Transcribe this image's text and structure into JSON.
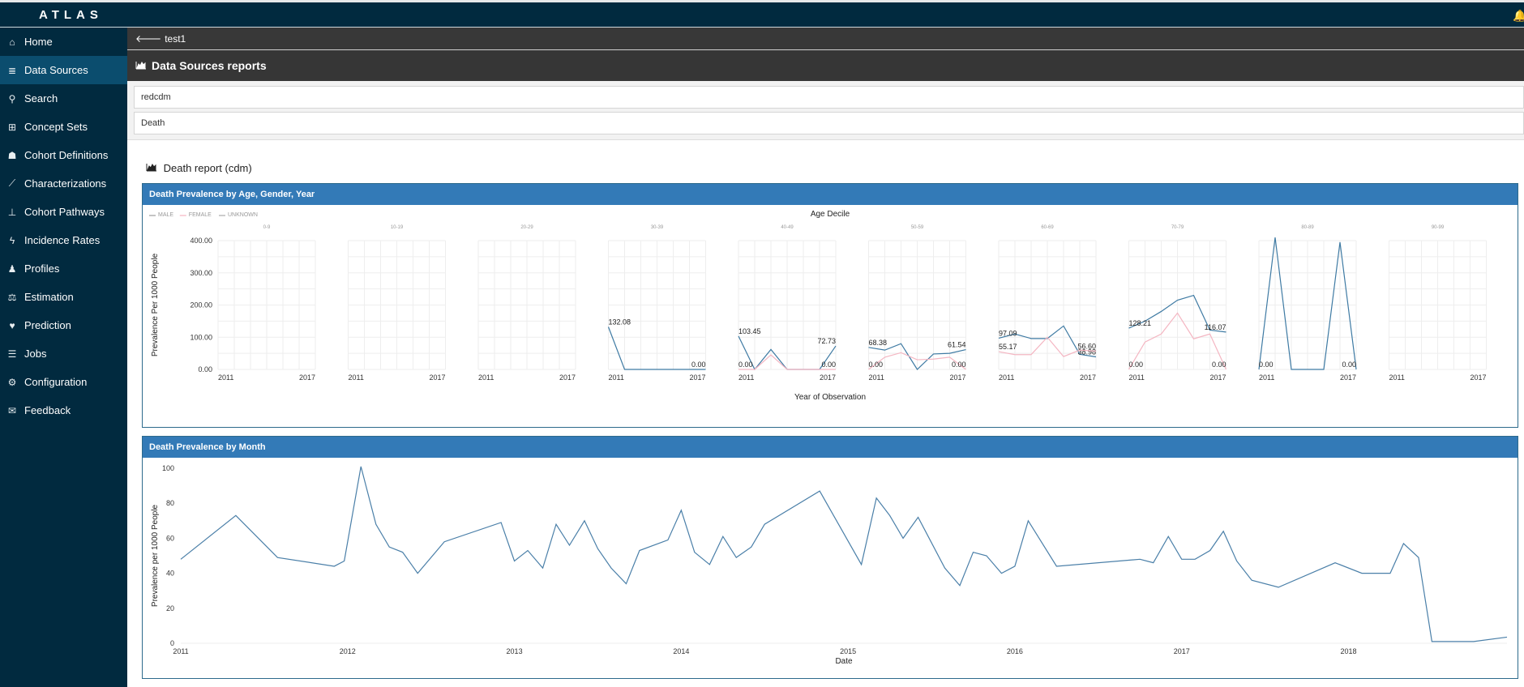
{
  "app": {
    "brand": "ATLAS",
    "notification_icon": "bell-icon"
  },
  "sidebar": {
    "items": [
      {
        "label": "Home",
        "icon": "home-icon",
        "glyph": "⌂",
        "active": false
      },
      {
        "label": "Data Sources",
        "icon": "database-icon",
        "glyph": "≣",
        "active": true
      },
      {
        "label": "Search",
        "icon": "search-icon",
        "glyph": "⚲",
        "active": false
      },
      {
        "label": "Concept Sets",
        "icon": "cart-icon",
        "glyph": "⊞",
        "active": false
      },
      {
        "label": "Cohort Definitions",
        "icon": "users-icon",
        "glyph": "☗",
        "active": false
      },
      {
        "label": "Characterizations",
        "icon": "line-chart-icon",
        "glyph": "⟋",
        "active": false
      },
      {
        "label": "Cohort Pathways",
        "icon": "sitemap-icon",
        "glyph": "⊥",
        "active": false
      },
      {
        "label": "Incidence Rates",
        "icon": "bolt-icon",
        "glyph": "ϟ",
        "active": false
      },
      {
        "label": "Profiles",
        "icon": "user-icon",
        "glyph": "♟",
        "active": false
      },
      {
        "label": "Estimation",
        "icon": "balance-scale-icon",
        "glyph": "⚖",
        "active": false
      },
      {
        "label": "Prediction",
        "icon": "heartbeat-icon",
        "glyph": "♥",
        "active": false
      },
      {
        "label": "Jobs",
        "icon": "list-icon",
        "glyph": "☰",
        "active": false
      },
      {
        "label": "Configuration",
        "icon": "cogs-icon",
        "glyph": "⚙",
        "active": false
      },
      {
        "label": "Feedback",
        "icon": "comment-icon",
        "glyph": "✉",
        "active": false
      }
    ]
  },
  "breadcrumb": {
    "back_label": "test1",
    "back_glyph": "🡐"
  },
  "page": {
    "title": "Data Sources reports",
    "title_icon": "area-chart-icon"
  },
  "selectors": {
    "source": "redcdm",
    "report": "Death"
  },
  "report": {
    "title": "Death report (cdm)"
  },
  "panels": {
    "age_gender_year": "Death Prevalence by Age, Gender, Year",
    "by_month": "Death Prevalence by Month"
  },
  "chart_data": [
    {
      "type": "line",
      "title": "Death Prevalence by Age, Gender, Year",
      "facet_title": "Age Decile",
      "xlabel": "Year of Observation",
      "ylabel": "Prevalence Per 1000 People",
      "ylim": [
        0,
        400
      ],
      "yticks": [
        "0.00",
        "100.00",
        "200.00",
        "300.00",
        "400.00"
      ],
      "x": [
        2011,
        2012,
        2013,
        2014,
        2015,
        2016,
        2017
      ],
      "xticks": [
        "2011",
        "2017"
      ],
      "legend": [
        "MALE",
        "FEMALE",
        "UNKNOWN"
      ],
      "legend_position": "top-left",
      "series_colors": {
        "MALE": "#1f77b4",
        "FEMALE": "#f4a6b4",
        "UNKNOWN": "#999999"
      },
      "facets": [
        {
          "label": "0-9",
          "series": []
        },
        {
          "label": "10-19",
          "series": []
        },
        {
          "label": "20-29",
          "series": []
        },
        {
          "label": "30-39",
          "series": [
            {
              "name": "MALE",
              "values": [
                132.08,
                0,
                0,
                0,
                0,
                0,
                0
              ]
            }
          ],
          "labels": [
            "132.08",
            "0.00"
          ]
        },
        {
          "label": "40-49",
          "series": [
            {
              "name": "MALE",
              "values": [
                103.45,
                0,
                62,
                0,
                0,
                0,
                72.73
              ]
            },
            {
              "name": "FEMALE",
              "values": [
                0,
                0,
                45,
                0,
                0,
                0,
                0
              ]
            }
          ],
          "labels": [
            "103.45",
            "0.00",
            "72.73",
            "0.00"
          ]
        },
        {
          "label": "50-59",
          "series": [
            {
              "name": "MALE",
              "values": [
                68.38,
                60,
                80,
                0,
                48,
                50,
                61.54
              ]
            },
            {
              "name": "FEMALE",
              "values": [
                0,
                38,
                52,
                30,
                32,
                38,
                0
              ]
            }
          ],
          "labels": [
            "68.38",
            "0.00",
            "61.54",
            "0.00"
          ]
        },
        {
          "label": "60-69",
          "series": [
            {
              "name": "MALE",
              "values": [
                97.09,
                110,
                96,
                96,
                135,
                47,
                38.98
              ]
            },
            {
              "name": "FEMALE",
              "values": [
                55.17,
                46,
                46,
                100,
                40,
                60,
                56.6
              ]
            }
          ],
          "labels": [
            "97.09",
            "55.17",
            "56.60",
            "38.98"
          ]
        },
        {
          "label": "70-79",
          "series": [
            {
              "name": "MALE",
              "values": [
                128.21,
                150,
                180,
                215,
                230,
                122,
                116.07
              ]
            },
            {
              "name": "FEMALE",
              "values": [
                0,
                85,
                110,
                175,
                95,
                110,
                0
              ]
            }
          ],
          "labels": [
            "128.21",
            "116.07",
            "0.00",
            "0.00"
          ]
        },
        {
          "label": "80-89",
          "series": [
            {
              "name": "MALE",
              "values": [
                0,
                410,
                0,
                0,
                0,
                395,
                0
              ]
            }
          ],
          "labels": [
            "0.00",
            "0.00"
          ]
        },
        {
          "label": "90-99",
          "series": []
        }
      ]
    },
    {
      "type": "line",
      "title": "Death Prevalence by Month",
      "xlabel": "Date",
      "ylabel": "Prevalence per 1000 People",
      "ylim": [
        0,
        100
      ],
      "yticks": [
        0,
        20,
        40,
        60,
        80,
        100
      ],
      "xticks": [
        "2011",
        "2012",
        "2013",
        "2014",
        "2015",
        "2016",
        "2017",
        "2018"
      ],
      "xlim": [
        2011.0,
        2018.95
      ],
      "color": "#4a7fa8",
      "points": [
        [
          2011.0,
          48
        ],
        [
          2011.33,
          73
        ],
        [
          2011.58,
          49
        ],
        [
          2011.92,
          44
        ],
        [
          2011.98,
          47
        ],
        [
          2012.08,
          101
        ],
        [
          2012.17,
          68
        ],
        [
          2012.25,
          55
        ],
        [
          2012.33,
          52
        ],
        [
          2012.42,
          40
        ],
        [
          2012.58,
          58
        ],
        [
          2012.92,
          69
        ],
        [
          2013.0,
          47
        ],
        [
          2013.08,
          53
        ],
        [
          2013.17,
          43
        ],
        [
          2013.25,
          68
        ],
        [
          2013.33,
          56
        ],
        [
          2013.42,
          70
        ],
        [
          2013.5,
          54
        ],
        [
          2013.58,
          43
        ],
        [
          2013.67,
          34
        ],
        [
          2013.75,
          53
        ],
        [
          2013.92,
          59
        ],
        [
          2014.0,
          76
        ],
        [
          2014.08,
          52
        ],
        [
          2014.17,
          45
        ],
        [
          2014.25,
          61
        ],
        [
          2014.33,
          49
        ],
        [
          2014.42,
          55
        ],
        [
          2014.5,
          68
        ],
        [
          2014.83,
          87
        ],
        [
          2015.08,
          45
        ],
        [
          2015.17,
          83
        ],
        [
          2015.25,
          73
        ],
        [
          2015.33,
          60
        ],
        [
          2015.42,
          72
        ],
        [
          2015.58,
          43
        ],
        [
          2015.67,
          33
        ],
        [
          2015.75,
          52
        ],
        [
          2015.83,
          50
        ],
        [
          2015.92,
          40
        ],
        [
          2016.0,
          44
        ],
        [
          2016.08,
          70
        ],
        [
          2016.25,
          44
        ],
        [
          2016.75,
          48
        ],
        [
          2016.83,
          46
        ],
        [
          2016.92,
          61
        ],
        [
          2017.0,
          48
        ],
        [
          2017.08,
          48
        ],
        [
          2017.17,
          53
        ],
        [
          2017.25,
          64
        ],
        [
          2017.33,
          47
        ],
        [
          2017.42,
          36
        ],
        [
          2017.58,
          32
        ],
        [
          2017.92,
          46
        ],
        [
          2018.08,
          40
        ],
        [
          2018.25,
          40
        ],
        [
          2018.33,
          57
        ],
        [
          2018.42,
          49
        ],
        [
          2018.5,
          1
        ],
        [
          2018.75,
          1
        ],
        [
          2018.95,
          3.5
        ]
      ]
    }
  ]
}
